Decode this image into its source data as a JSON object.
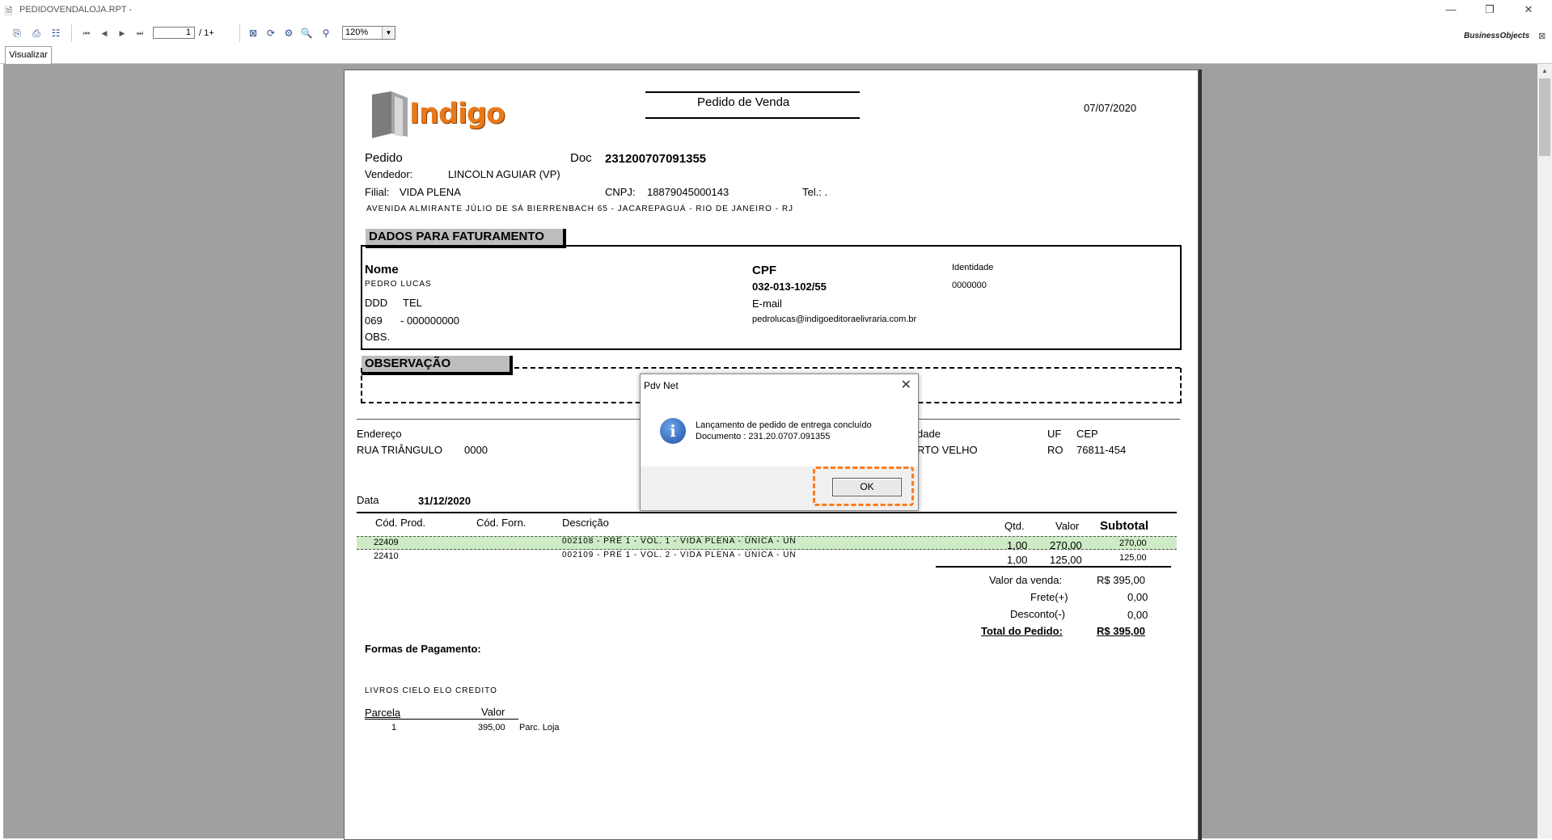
{
  "window": {
    "title": "PEDIDOVENDALOJA.RPT -",
    "minimize": "—",
    "restore": "❐",
    "close": "✕"
  },
  "toolbar": {
    "page_current": "1",
    "page_total": "/ 1+",
    "zoom": "120%",
    "brand": "BusinessObjects",
    "icons": [
      "export-icon",
      "print-icon",
      "group-tree-icon",
      "first-page-icon",
      "prev-page-icon",
      "next-page-icon",
      "last-page-icon",
      "close-view-icon",
      "refresh-icon",
      "search-replace-icon",
      "search-icon",
      "binoculars-icon"
    ]
  },
  "tab": {
    "label": "Visualizar"
  },
  "report": {
    "logo_text": "Indigo",
    "title": "Pedido de Venda",
    "date": "07/07/2020",
    "pedido_label": "Pedido",
    "doc_label": "Doc",
    "doc_number": "231200707091355",
    "vendedor_label": "Vendedor:",
    "vendedor": "LINCOLN AGUIAR (VP)",
    "filial_label": "Filial:",
    "filial": "VIDA PLENA",
    "cnpj_label": "CNPJ:",
    "cnpj": "18879045000143",
    "tel_label": "Tel.: .",
    "address": "AVENIDA ALMIRANTE JÚLIO DE SÁ BIERRENBACH   65 - JACAREPAGUÁ - RIO DE JANEIRO - RJ",
    "fat_header": "DADOS PARA FATURAMENTO",
    "nome_label": "Nome",
    "nome": "PEDRO LUCAS",
    "cpf_label": "CPF",
    "cpf": "032-013-102/55",
    "identidade_label": "Identidade",
    "identidade": "0000000",
    "ddd_label": "DDD",
    "tel2_label": "TEL",
    "ddd": "069",
    "tel": "- 000000000",
    "email_label": "E-mail",
    "email": "pedrolucas@indigoeditoraelivraria.com.br",
    "obs_label": "OBS.",
    "obs_header": "OBSERVAÇÃO",
    "endereco_label": "Endereço",
    "endereco": "RUA TRIÂNGULO",
    "numero": "0000",
    "cidade_label": "dade",
    "cidade": "RTO VELHO",
    "uf_label": "UF",
    "uf": "RO",
    "cep_label": "CEP",
    "cep": "76811-454",
    "data_label": "Data",
    "data": "31/12/2020",
    "columns": {
      "cod_prod": "Cód. Prod.",
      "cod_forn": "Cód. Forn.",
      "descricao": "Descrição",
      "qtd": "Qtd.",
      "valor": "Valor",
      "subtotal": "Subtotal"
    },
    "items": [
      {
        "cod": "22409",
        "desc": "002108 - PRÉ 1 - VOL. 1 - VIDA PLENA - ÚNICA - UN",
        "qtd": "1,00",
        "valor": "270,00",
        "subtotal": "270,00"
      },
      {
        "cod": "22410",
        "desc": "002109 - PRÉ 1 - VOL. 2 - VIDA PLENA - ÚNICA - UN",
        "qtd": "1,00",
        "valor": "125,00",
        "subtotal": "125,00"
      }
    ],
    "totals": {
      "venda_label": "Valor da venda:",
      "venda": "R$ 395,00",
      "frete_label": "Frete(+)",
      "frete": "0,00",
      "desconto_label": "Desconto(-)",
      "desconto": "0,00",
      "total_label": "Total do Pedido:",
      "total": "R$ 395,00"
    },
    "pagamento_header": "Formas de Pagamento:",
    "pagamento_forma": "LIVROS CIELO ELO CREDITO",
    "parcela_label": "Parcela",
    "valor_label": "Valor",
    "parcela_num": "1",
    "parcela_valor": "395,00",
    "parcela_desc": "Parc. Loja"
  },
  "dialog": {
    "title": "Pdv Net",
    "close": "✕",
    "icon_glyph": "i",
    "line1": "Lançamento de pedido de entrega concluído",
    "line2": "Documento : 231.20.0707.091355",
    "ok_label": "OK"
  }
}
